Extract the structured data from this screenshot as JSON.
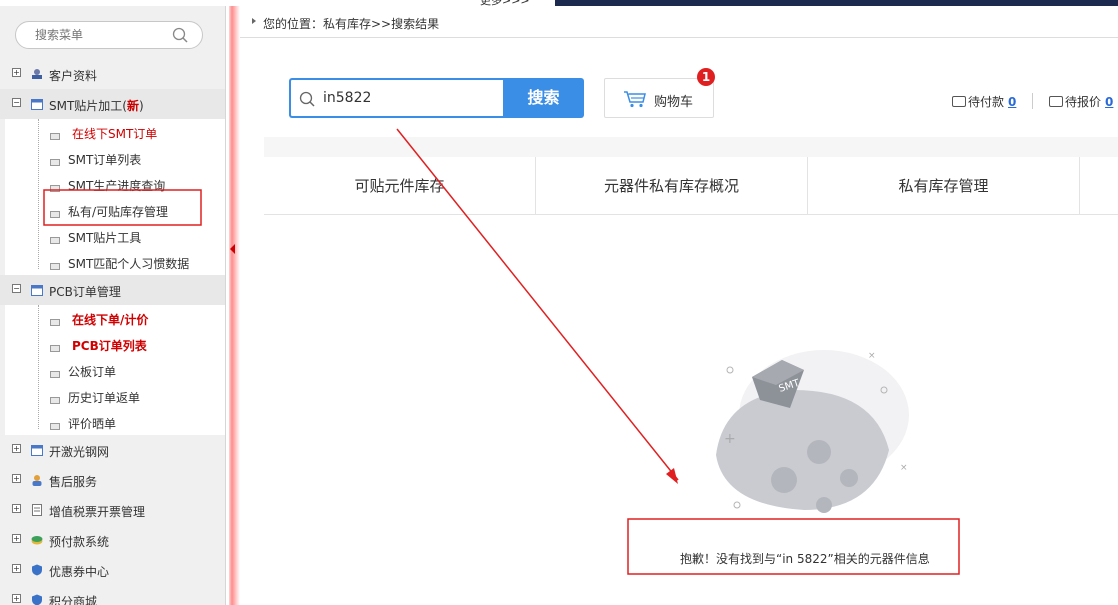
{
  "top": {
    "more_text": "更多>>>"
  },
  "sidebar": {
    "search_placeholder": "搜索菜单",
    "groups": [
      {
        "label": "客户资料",
        "toggle": "+"
      },
      {
        "label": "SMT贴片加工(",
        "new_tag": "新",
        "label_end": ")",
        "toggle": "−"
      },
      {
        "label": "PCB订单管理",
        "toggle": "−"
      },
      {
        "label": "开激光钢网",
        "toggle": "+"
      },
      {
        "label": "售后服务",
        "toggle": "+"
      },
      {
        "label": "增值税票开票管理",
        "toggle": "+"
      },
      {
        "label": "预付款系统",
        "toggle": "+"
      },
      {
        "label": "优惠券中心",
        "toggle": "+"
      },
      {
        "label": "积分商城",
        "toggle": "+"
      }
    ],
    "smt_items": [
      "在线下SMT订单",
      "SMT订单列表",
      "SMT生产进度查询",
      "私有/可贴库存管理",
      "SMT贴片工具",
      "SMT匹配个人习惯数据"
    ],
    "pcb_items": [
      "在线下单/计价",
      "PCB订单列表",
      "公板订单",
      "历史订单返单",
      "评价晒单"
    ]
  },
  "breadcrumb": {
    "text": "您的位置：私有库存>>搜索结果"
  },
  "search": {
    "value": "in5822",
    "button": "搜索"
  },
  "cart": {
    "label": "购物车",
    "badge": "1"
  },
  "status": {
    "pending_pay_label": "待付款",
    "pending_pay_count": "0",
    "pending_quote_label": "待报价",
    "pending_quote_count": "0"
  },
  "tabs": [
    "可贴元件库存",
    "元器件私有库存概况",
    "私有库存管理"
  ],
  "empty": {
    "badge_text": "SMT",
    "message": "抱歉！没有找到与“in 5822”相关的元器件信息"
  },
  "annotation_color": "#e02020"
}
